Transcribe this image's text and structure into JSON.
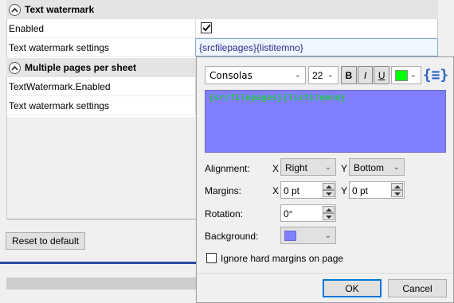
{
  "grid": {
    "section1": "Text watermark",
    "rows1": [
      {
        "label": "Enabled",
        "checked": true
      },
      {
        "label": "Text watermark settings",
        "value": "{srcfilepages}{listitemno}"
      }
    ],
    "section2": "Multiple pages per sheet",
    "rows2": [
      {
        "label": "TextWatermark.Enabled"
      },
      {
        "label": "Text watermark settings"
      }
    ],
    "reset_label": "Reset to default"
  },
  "popup": {
    "font": "Consolas",
    "size": "22",
    "bold": "B",
    "italic": "I",
    "underline": "U",
    "color": "#00ff00",
    "macro_icon_glyph": "{≡}",
    "text": "{srcfilepages}{listitemno}",
    "text_bg": "#8080ff",
    "alignment_label": "Alignment:",
    "x_label": "X",
    "y_label": "Y",
    "align_x": "Right",
    "align_y": "Bottom",
    "margins_label": "Margins:",
    "margin_x": "0 pt",
    "margin_y": "0 pt",
    "rotation_label": "Rotation:",
    "rotation": "0°",
    "background_label": "Background:",
    "background_color": "#8080ff",
    "ignore_label": "Ignore hard margins on page",
    "ok_label": "OK",
    "cancel_label": "Cancel"
  }
}
